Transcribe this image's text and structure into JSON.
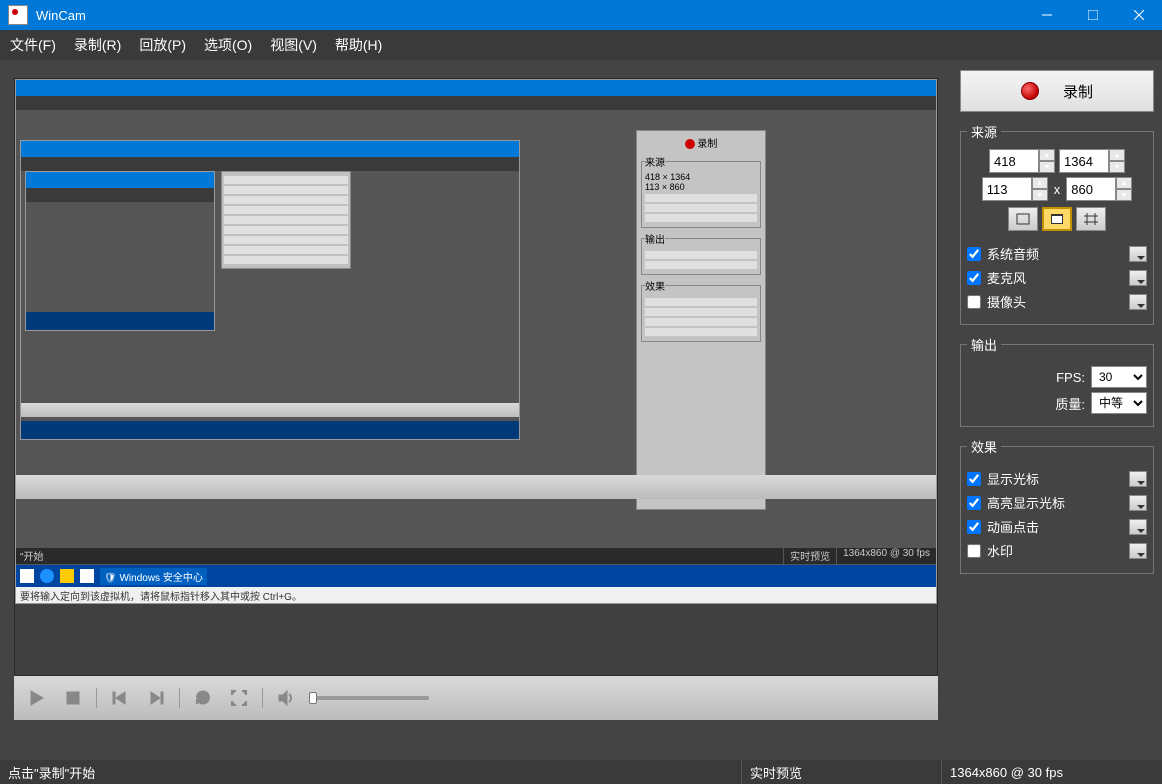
{
  "titlebar": {
    "title": "WinCam"
  },
  "menu": {
    "file": "文件(F)",
    "record": "录制(R)",
    "playback": "回放(P)",
    "options": "选项(O)",
    "view": "视图(V)",
    "help": "帮助(H)"
  },
  "sidebar": {
    "record_btn": "录制",
    "source": {
      "legend": "来源",
      "x1": "418",
      "y1": "1364",
      "x2": "113",
      "y2": "860",
      "sys_audio": "系统音频",
      "mic": "麦克风",
      "camera": "摄像头",
      "sys_audio_checked": true,
      "mic_checked": true,
      "camera_checked": false
    },
    "output": {
      "legend": "输出",
      "fps_label": "FPS:",
      "fps_value": "30",
      "quality_label": "质量:",
      "quality_value": "中等"
    },
    "effects": {
      "legend": "效果",
      "show_cursor": "显示光标",
      "highlight_cursor": "高亮显示光标",
      "animate_click": "动画点击",
      "watermark": "水印",
      "show_cursor_checked": true,
      "highlight_cursor_checked": true,
      "animate_click_checked": true,
      "watermark_checked": false
    }
  },
  "status": {
    "left": "点击\"录制\"开始",
    "preview": "实时预览",
    "resolution": "1364x860 @ 30 fps"
  },
  "nested_preview": {
    "status": "1364x860 @ 30 fps",
    "preview_label": "实时预览",
    "hint": "要将输入定向到该虚拟机，请将鼠标指针移入其中或按 Ctrl+G。",
    "task_label": "Windows 安全中心"
  }
}
